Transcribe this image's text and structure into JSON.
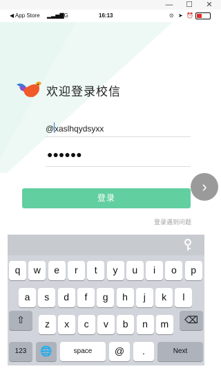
{
  "window": {
    "controls": [
      "—",
      "☐",
      "✕"
    ]
  },
  "status_bar": {
    "back_label": "◀ App Store",
    "signal_label": "4G",
    "time": "16:13"
  },
  "app": {
    "title": "欢迎登录校信"
  },
  "form": {
    "username_value": "xaslhqydsyxx",
    "username_prefix": "@",
    "password_mask": "●●●●●●",
    "login_button": "登录",
    "help_link": "登录遇到问题"
  },
  "side_button": {
    "glyph": "›"
  },
  "keyboard": {
    "row1": [
      "q",
      "w",
      "e",
      "r",
      "t",
      "y",
      "u",
      "i",
      "o",
      "p"
    ],
    "row2": [
      "a",
      "s",
      "d",
      "f",
      "g",
      "h",
      "j",
      "k",
      "l"
    ],
    "row3": [
      "z",
      "x",
      "c",
      "v",
      "b",
      "n",
      "m"
    ],
    "bottom": {
      "numbers": "123",
      "space": "space",
      "at": "@",
      "dot": ".",
      "next": "Next"
    }
  },
  "colors": {
    "accent": "#62cfa0",
    "band": "#e3f6f0"
  }
}
